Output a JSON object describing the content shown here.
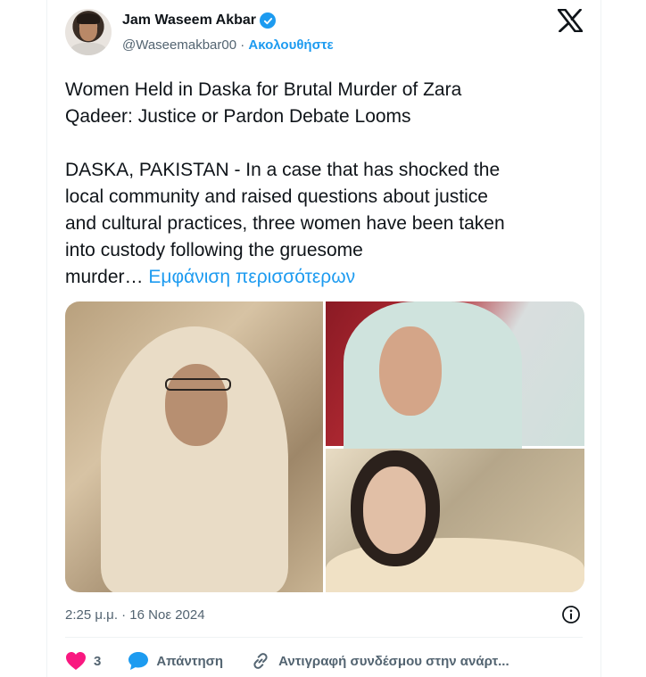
{
  "author": {
    "display_name": "Jam Waseem Akbar",
    "handle": "@Waseemakbar00",
    "separator": " · ",
    "follow_label": "Ακολουθήστε",
    "verified": true
  },
  "tweet": {
    "text": "Women Held in Daska for Brutal Murder of Zara\nQadeer: Justice or Pardon Debate Looms\n\nDASKA, PAKISTAN - In a case that has shocked the\nlocal community and raised questions about justice\nand cultural practices, three women have been taken\ninto custody following the gruesome\nmurder…",
    "show_more_label": " Εμφάνιση περισσότερων",
    "timestamp": "2:25 μ.μ. · 16 Νοε 2024"
  },
  "media": {
    "images": [
      {
        "icon": "photo-woman-glasses-headscarf"
      },
      {
        "icon": "photo-woman-green-scarf"
      },
      {
        "icon": "photo-woman-cream-scarf"
      }
    ]
  },
  "actions": {
    "like_count": "3",
    "reply_label": "Απάντηση",
    "copy_link_label": "Αντιγραφή συνδέσμου στην ανάρτ..."
  },
  "colors": {
    "accent": "#1d9bf0",
    "like": "#f91880",
    "text": "#0f1419",
    "muted": "#536471"
  }
}
